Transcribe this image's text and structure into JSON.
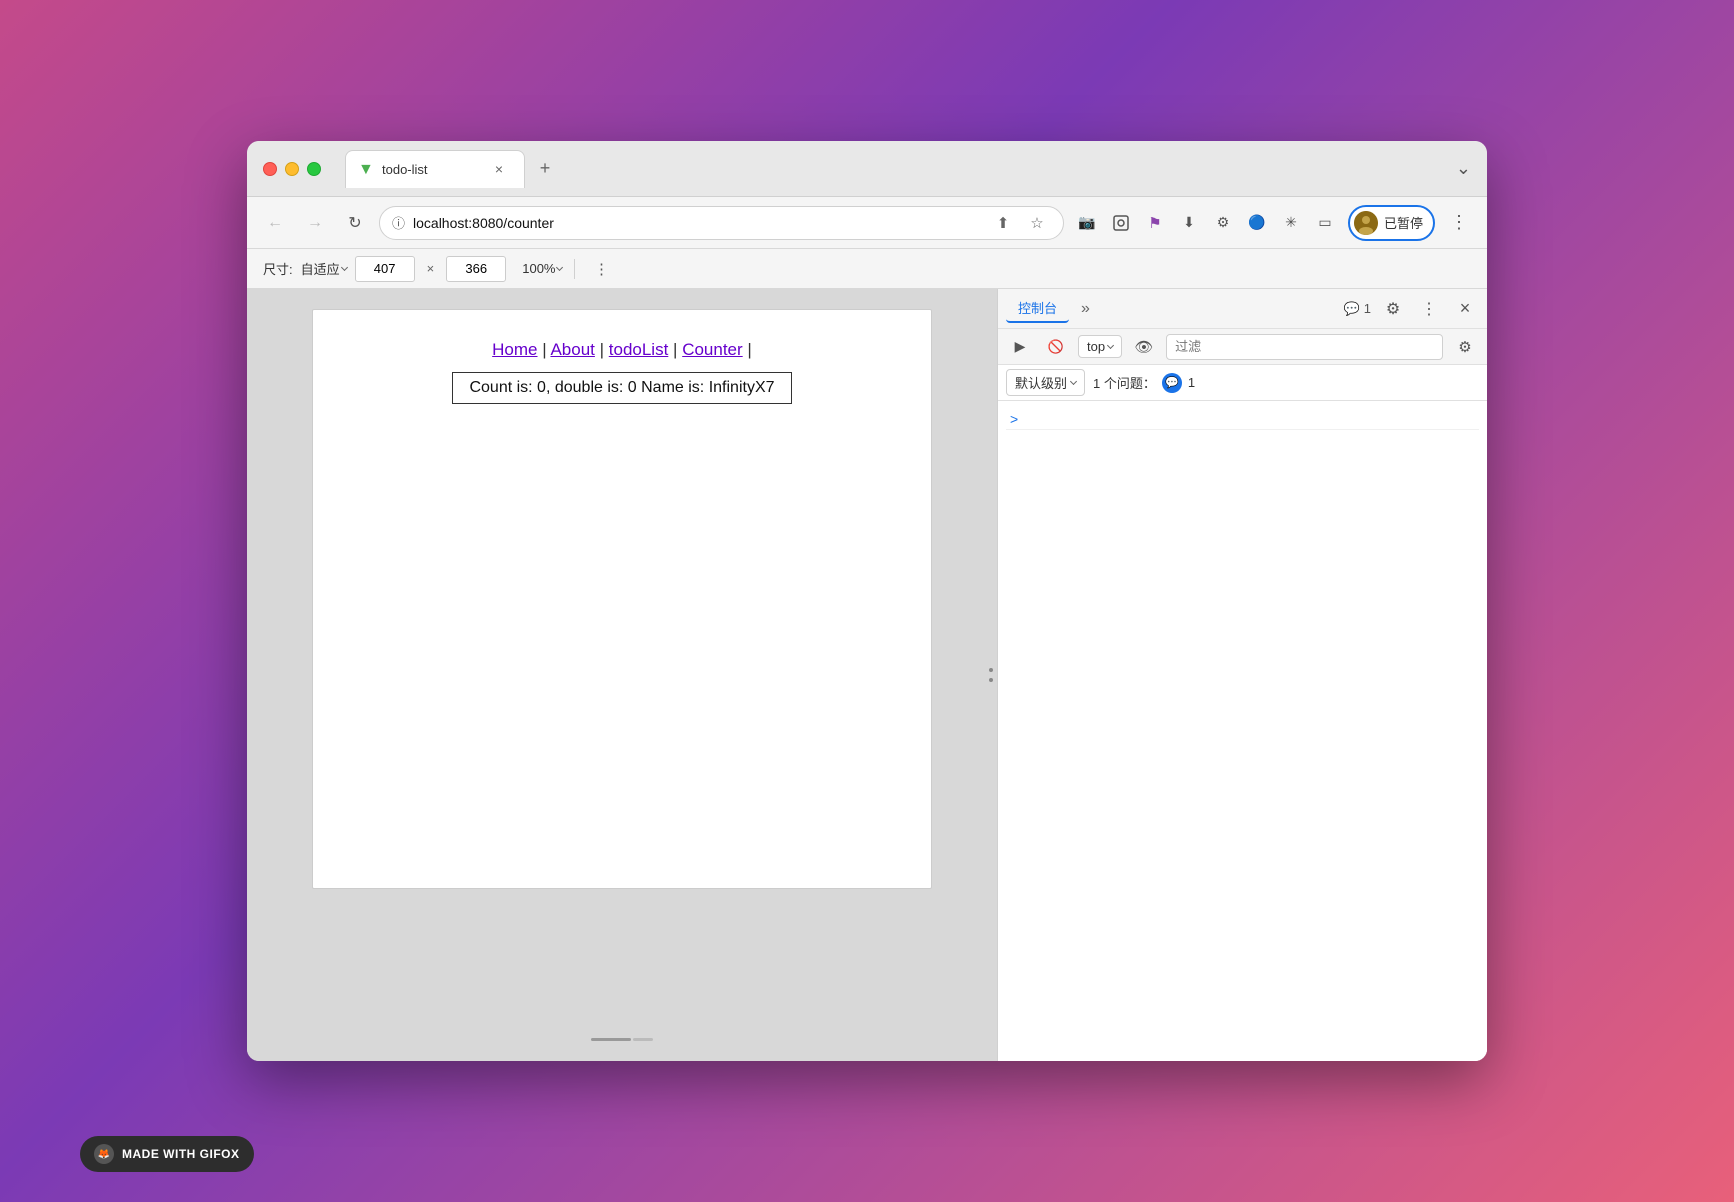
{
  "browser": {
    "tab": {
      "favicon": "V",
      "title": "todo-list",
      "close_label": "×"
    },
    "tab_add": "+",
    "tab_more": "⌄",
    "nav": {
      "back": "←",
      "forward": "→",
      "refresh": "↻",
      "url_icon": "ⓘ",
      "url": "localhost:8080/counter",
      "share": "⬆",
      "bookmark": "☆",
      "camera": "📷",
      "extensions_label": "..."
    },
    "toolbar": {
      "size_label": "尺寸:",
      "size_preset": "自适应",
      "width": "407",
      "height": "366",
      "separator": "×",
      "zoom": "100%",
      "more_btn": "⋮"
    },
    "profile": {
      "label": "已暂停"
    }
  },
  "page": {
    "nav_links": [
      {
        "text": "Home",
        "href": "#"
      },
      {
        "text": "About",
        "href": "#"
      },
      {
        "text": "todoList",
        "href": "#"
      },
      {
        "text": "Counter",
        "href": "#"
      }
    ],
    "separators": [
      "|",
      "|",
      "|",
      "|"
    ],
    "counter_text": "Count is: 0, double is: 0 Name is: InfinityX7"
  },
  "devtools": {
    "tabs": [
      {
        "label": "控制台",
        "active": true
      },
      {
        "label": "»",
        "active": false
      }
    ],
    "badge": {
      "icon": "💬",
      "count": "1"
    },
    "actions": {
      "settings": "⚙",
      "more": "⋮",
      "close": "×"
    },
    "toolbar": {
      "play_btn": "▶",
      "stop_btn": "🚫",
      "context_dropdown": "top",
      "eye_btn": "👁",
      "filter_placeholder": "过滤",
      "settings_btn": "⚙"
    },
    "level_row": {
      "level_label": "默认级别",
      "issues_label": "1 个问题：",
      "issue_count": "1",
      "issue_icon": "💬"
    },
    "console_prompt": ">"
  },
  "gifox": {
    "label": "MADE WITH GIFOX"
  }
}
